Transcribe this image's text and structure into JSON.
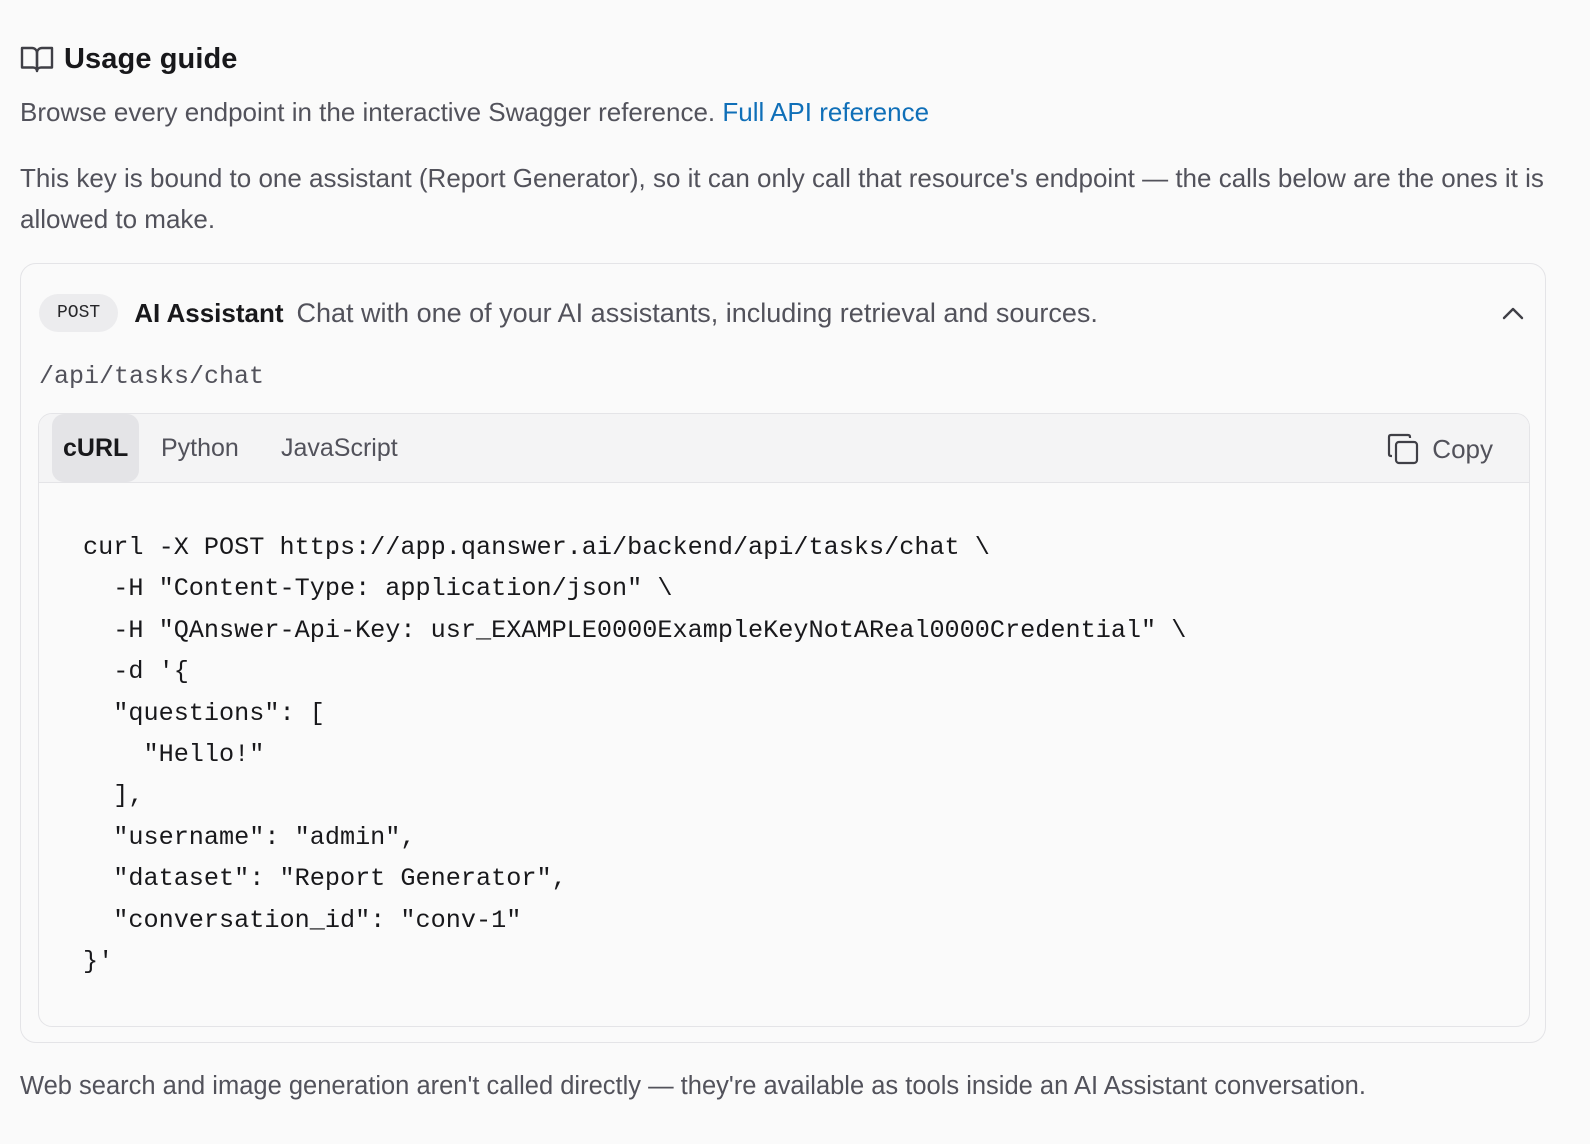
{
  "guide": {
    "icon": "book-open-icon",
    "title": "Usage guide",
    "intro_text": "Browse every endpoint in the interactive Swagger reference.",
    "reference_link": "Full API reference",
    "scope_note": "This key is bound to one assistant (Report Generator), so it can only call that resource's endpoint — the calls below are the ones it is allowed to make.",
    "footnote": "Web search and image generation aren't called directly — they're available as tools inside an AI Assistant conversation."
  },
  "endpoint": {
    "method": "POST",
    "name": "AI Assistant",
    "description": "Chat with one of your AI assistants, including retrieval and sources.",
    "path": "/api/tasks/chat",
    "collapse_icon": "chevron-up-icon"
  },
  "code_panel": {
    "tabs": [
      {
        "label": "cURL",
        "active": true
      },
      {
        "label": "Python",
        "active": false
      },
      {
        "label": "JavaScript",
        "active": false
      }
    ],
    "copy_label": "Copy",
    "copy_icon": "copy-icon",
    "code_lines": [
      "curl -X POST https://app.qanswer.ai/backend/api/tasks/chat \\",
      "  -H \"Content-Type: application/json\" \\",
      "  -H \"QAnswer-Api-Key: usr_EXAMPLE0000ExampleKeyNotAReal0000Credential\" \\",
      "  -d '{",
      "  \"questions\": [",
      "    \"Hello!\"",
      "  ],",
      "  \"username\": \"admin\",",
      "  \"dataset\": \"Report Generator\",",
      "  \"conversation_id\": \"conv-1\"",
      "}'"
    ]
  },
  "colors": {
    "link": "#0f6fb8",
    "heading": "#18181b",
    "body_text": "#52525b",
    "border": "#e4e4e7",
    "background": "#fafafa"
  }
}
